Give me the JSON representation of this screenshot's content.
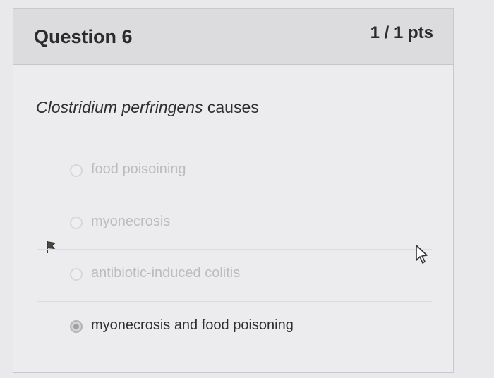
{
  "question": {
    "title": "Question 6",
    "points": "1 / 1 pts",
    "prompt_species": "Clostridium perfringens",
    "prompt_rest": " causes"
  },
  "answers": [
    {
      "label": "food poisoining",
      "selected": false
    },
    {
      "label": "myonecrosis",
      "selected": false
    },
    {
      "label": "antibiotic-induced colitis",
      "selected": false
    },
    {
      "label": "myonecrosis and food poisoning",
      "selected": true
    }
  ],
  "colors": {
    "header_bg": "#dcdcdf",
    "text": "#2f2f32",
    "unselected_text": "#bcbcc0"
  },
  "icons": {
    "marker": "flag-icon",
    "pointer": "mouse-cursor-icon"
  }
}
